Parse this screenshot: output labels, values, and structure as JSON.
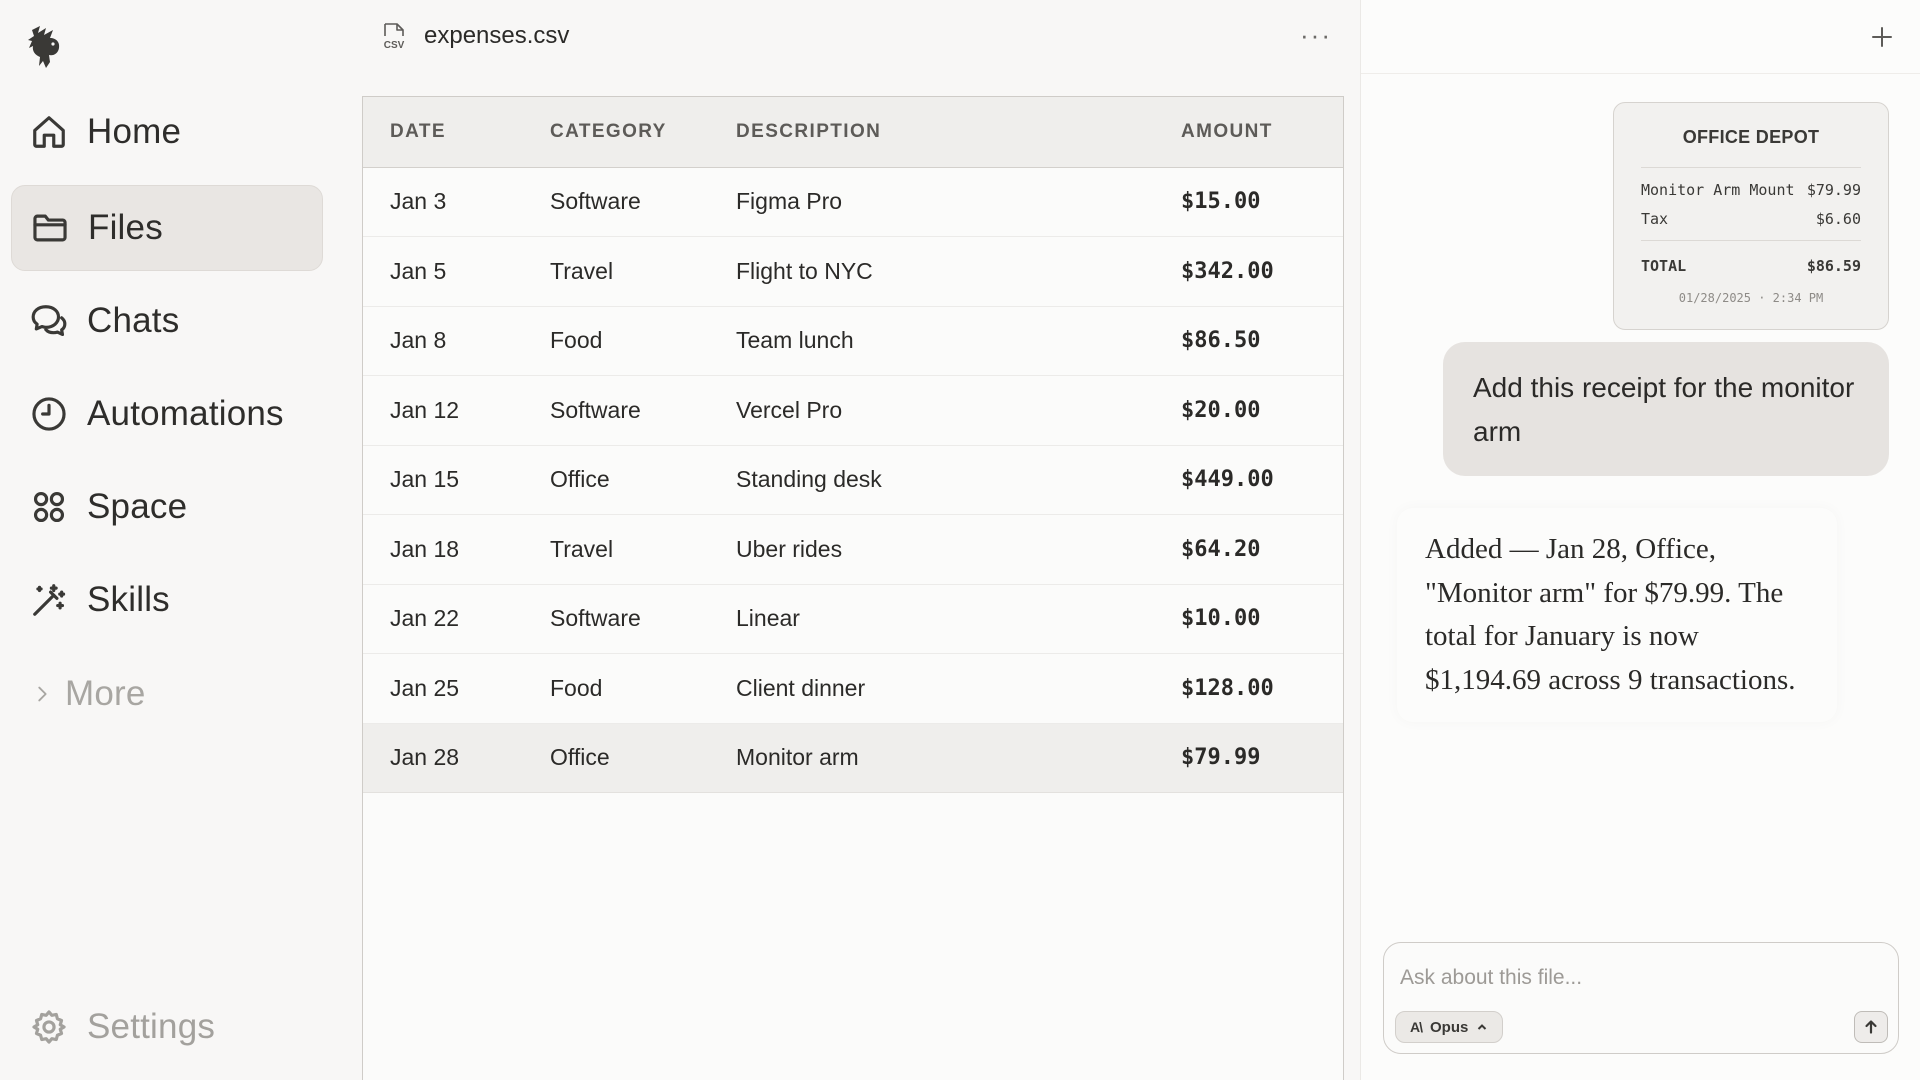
{
  "sidebar": {
    "items": [
      {
        "label": "Home",
        "icon": "home-icon"
      },
      {
        "label": "Files",
        "icon": "folder-icon",
        "active": true
      },
      {
        "label": "Chats",
        "icon": "chat-bubbles-icon"
      },
      {
        "label": "Automations",
        "icon": "clock-icon"
      },
      {
        "label": "Space",
        "icon": "grid-circles-icon"
      },
      {
        "label": "Skills",
        "icon": "magic-wand-icon"
      }
    ],
    "more_label": "More",
    "settings_label": "Settings"
  },
  "file": {
    "icon_text": "CSV",
    "title": "expenses.csv",
    "menu_label": "···"
  },
  "table": {
    "headers": [
      "DATE",
      "CATEGORY",
      "DESCRIPTION",
      "AMOUNT"
    ],
    "rows": [
      {
        "date": "Jan 3",
        "category": "Software",
        "description": "Figma Pro",
        "amount": "$15.00"
      },
      {
        "date": "Jan 5",
        "category": "Travel",
        "description": "Flight to NYC",
        "amount": "$342.00"
      },
      {
        "date": "Jan 8",
        "category": "Food",
        "description": "Team lunch",
        "amount": "$86.50"
      },
      {
        "date": "Jan 12",
        "category": "Software",
        "description": "Vercel Pro",
        "amount": "$20.00"
      },
      {
        "date": "Jan 15",
        "category": "Office",
        "description": "Standing desk",
        "amount": "$449.00"
      },
      {
        "date": "Jan 18",
        "category": "Travel",
        "description": "Uber rides",
        "amount": "$64.20"
      },
      {
        "date": "Jan 22",
        "category": "Software",
        "description": "Linear",
        "amount": "$10.00"
      },
      {
        "date": "Jan 25",
        "category": "Food",
        "description": "Client dinner",
        "amount": "$128.00"
      },
      {
        "date": "Jan 28",
        "category": "Office",
        "description": "Monitor arm",
        "amount": "$79.99"
      }
    ]
  },
  "chat": {
    "plus_label": "+",
    "receipt": {
      "store": "OFFICE DEPOT",
      "item_name": "Monitor Arm Mount",
      "item_price": "$79.99",
      "tax_label": "Tax",
      "tax_value": "$6.60",
      "total_label": "TOTAL",
      "total_value": "$86.59",
      "datetime": "01/28/2025 · 2:34 PM"
    },
    "user_message": "Add this receipt for the monitor arm",
    "assistant_message": "Added — Jan 28, Office, \"Monitor arm\" for $79.99. The total for January is now $1,194.69 across 9 transactions.",
    "composer": {
      "placeholder": "Ask about this file...",
      "model_glyph": "A\\",
      "model_label": "Opus"
    }
  }
}
